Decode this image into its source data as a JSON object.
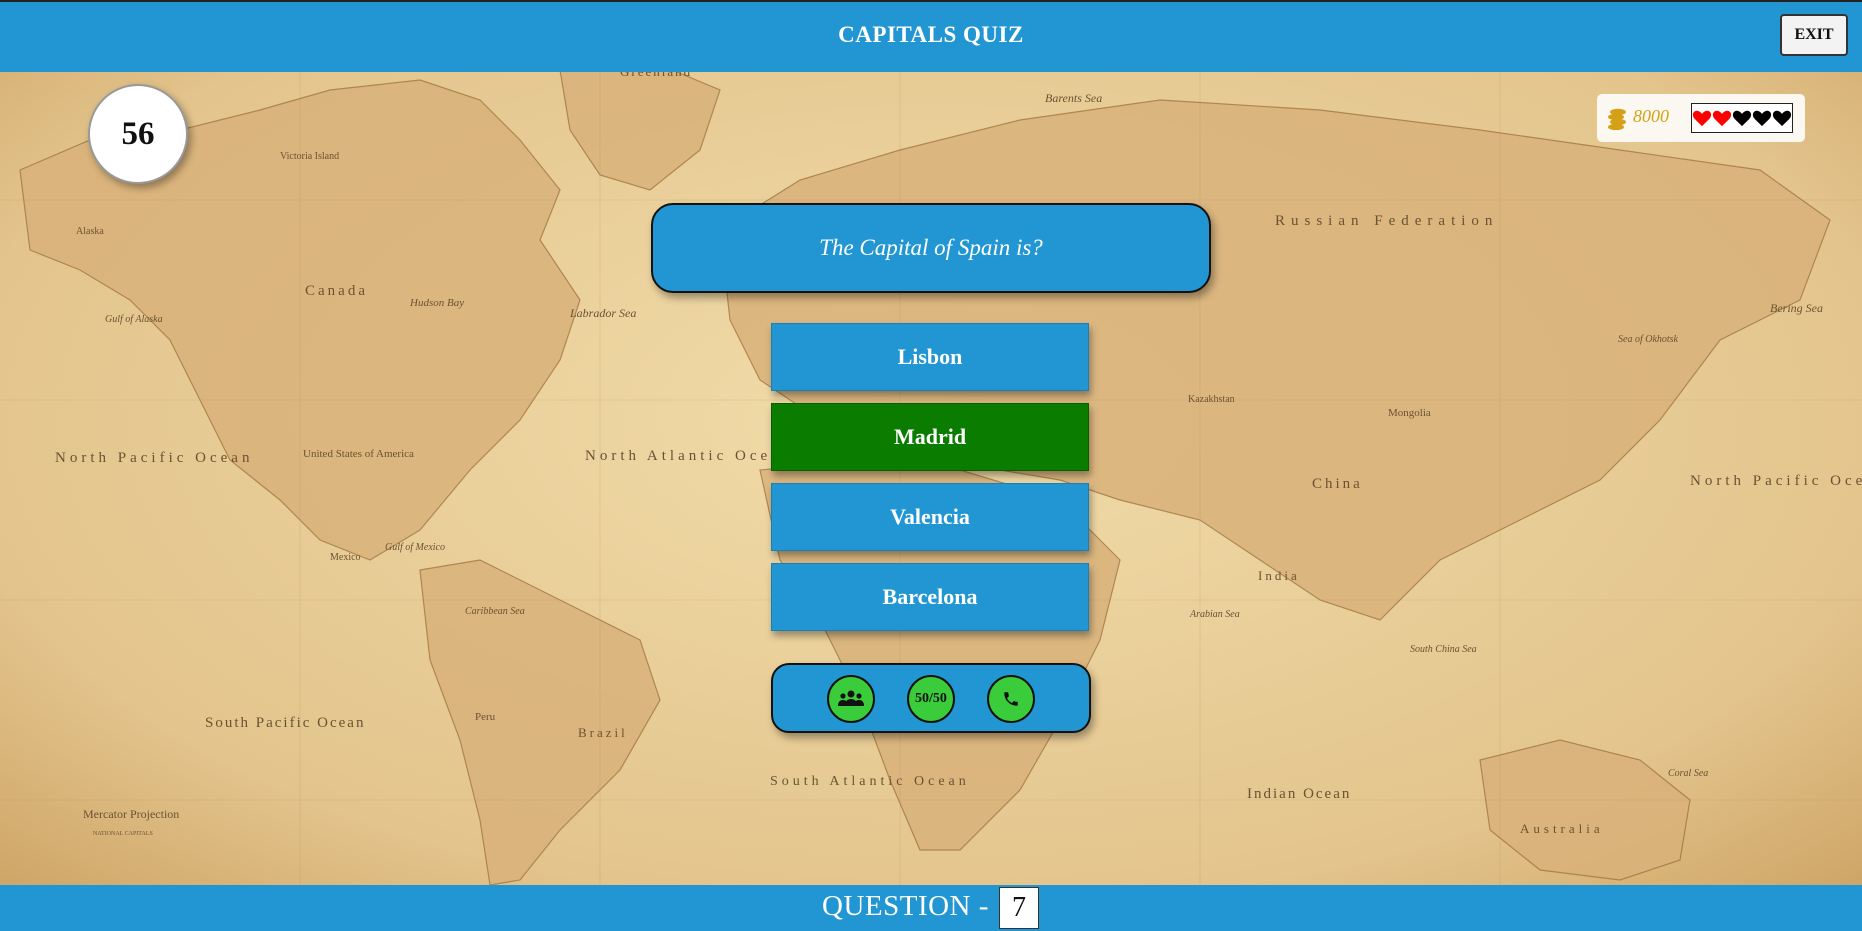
{
  "header": {
    "title": "CAPITALS QUIZ",
    "exit_label": "EXIT"
  },
  "timer": {
    "value": "56"
  },
  "status": {
    "coins": "8000",
    "lives_total": 5,
    "lives_remaining": 2,
    "life_color_active": "#ff0000",
    "life_color_lost": "#000000"
  },
  "question": {
    "text": "The Capital of  Spain is?"
  },
  "answers": [
    {
      "label": "Lisbon",
      "state": "default"
    },
    {
      "label": "Madrid",
      "state": "correct"
    },
    {
      "label": "Valencia",
      "state": "default"
    },
    {
      "label": "Barcelona",
      "state": "default"
    }
  ],
  "lifelines": {
    "audience_icon": "users-icon",
    "fifty_fifty_label": "50/50",
    "phone_icon": "phone-icon"
  },
  "footer": {
    "label": "QUESTION -",
    "number": "7"
  },
  "map_labels": {
    "greenland": "Greenland",
    "barents": "Barents Sea",
    "russia": "Russian Federation",
    "canada": "Canada",
    "hudson": "Hudson Bay",
    "labrador": "Labrador Sea",
    "victoria": "Victoria Island",
    "alaska": "Alaska",
    "gulf_alaska": "Gulf of Alaska",
    "bering": "Bering Sea",
    "okhotsk": "Sea of Okhotsk",
    "north_pacific_left": "North Pacific Ocean",
    "north_pacific_right": "North Pacific Ocean",
    "north_atlantic": "North Atlantic Ocean",
    "usa": "United States of America",
    "gulf_mexico": "Gulf of Mexico",
    "mexico": "Mexico",
    "caribbean": "Caribbean Sea",
    "china": "China",
    "india": "India",
    "mongolia": "Mongolia",
    "kazakhstan": "Kazakhstan",
    "south_china": "South China Sea",
    "arabian": "Arabian Sea",
    "brazil": "Brazil",
    "peru": "Peru",
    "south_pacific": "South Pacific Ocean",
    "south_atlantic": "South Atlantic Ocean",
    "indian_ocean": "Indian Ocean",
    "australia": "Australia",
    "coral": "Coral Sea",
    "mercator": "Mercator Projection",
    "national_capitals": "NATIONAL CAPITALS"
  },
  "colors": {
    "primary": "#2196d3",
    "correct": "#0a7d00",
    "lifeline": "#3bcc3b",
    "coins": "#d4a017"
  }
}
